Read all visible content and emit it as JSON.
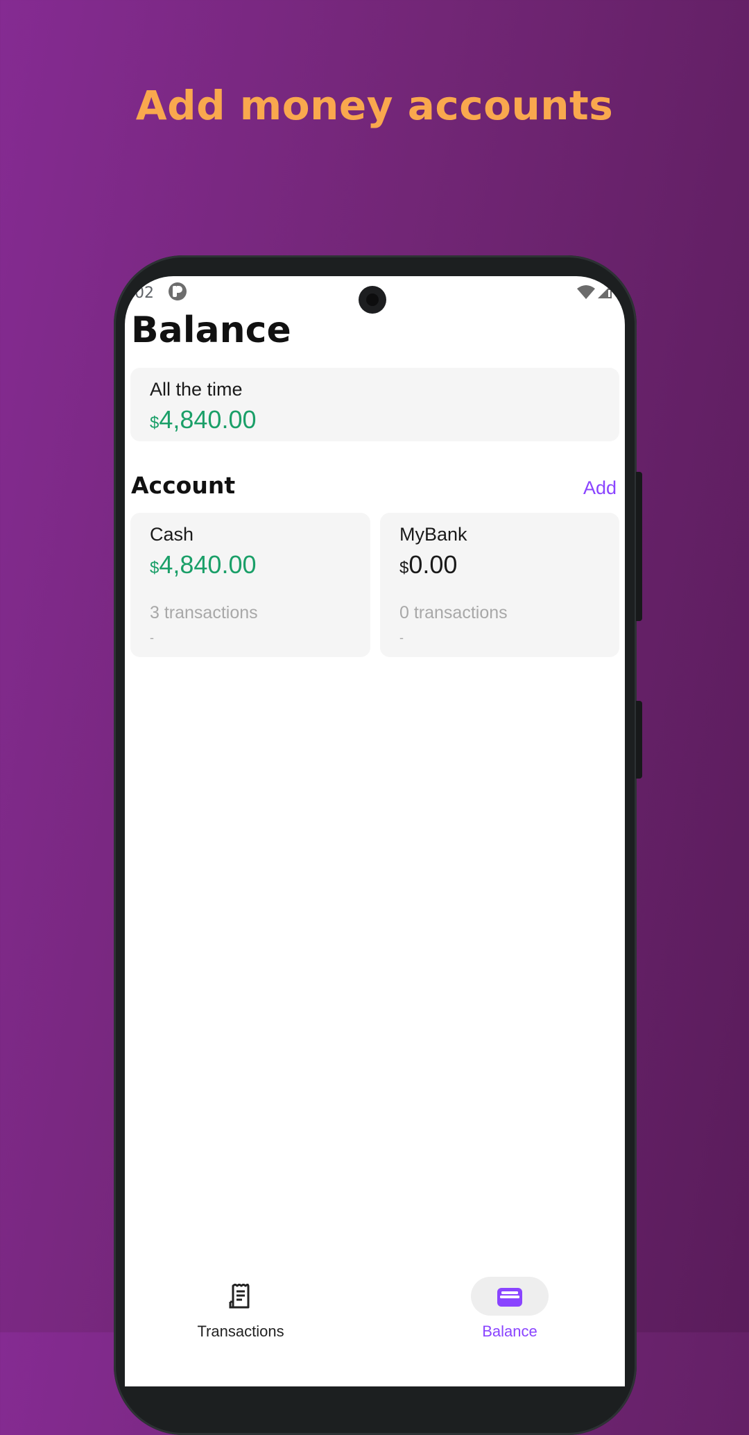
{
  "promo": {
    "title": "Add money accounts"
  },
  "status_bar": {
    "time": "02"
  },
  "screen": {
    "title": "Balance",
    "summary": {
      "label": "All the time",
      "currency": "$",
      "amount": "4,840.00"
    },
    "section": {
      "title": "Account",
      "add_label": "Add"
    },
    "accounts": [
      {
        "name": "Cash",
        "currency": "$",
        "amount": "4,840.00",
        "transactions": "3 transactions",
        "detail": "-",
        "color": "#1a9f68"
      },
      {
        "name": "MyBank",
        "currency": "$",
        "amount": "0.00",
        "transactions": "0 transactions",
        "detail": "-",
        "color": "#1a1a1a"
      }
    ]
  },
  "bottom_nav": {
    "items": [
      {
        "label": "Transactions",
        "icon": "receipt-icon",
        "active": false
      },
      {
        "label": "Balance",
        "icon": "wallet-icon",
        "active": true
      }
    ]
  },
  "colors": {
    "accent": "#8a44ff",
    "positive": "#1a9f68",
    "promo_title": "#f9a84e"
  }
}
